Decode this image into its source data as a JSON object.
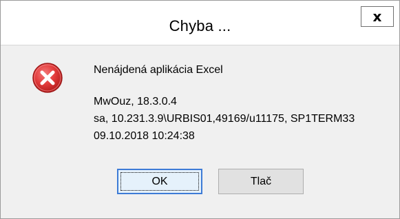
{
  "window": {
    "title": "Chyba ...",
    "close_label": "x"
  },
  "icon": {
    "name": "error-icon",
    "color": "#e33c3c"
  },
  "message": {
    "title": "Nenájdená aplikácia Excel",
    "lines": [
      "MwOuz, 18.3.0.4",
      "sa, 10.231.3.9\\URBIS01,49169/u11175, SP1TERM33",
      "09.10.2018 10:24:38"
    ]
  },
  "buttons": {
    "ok_label": "OK",
    "print_label": "Tlač"
  }
}
